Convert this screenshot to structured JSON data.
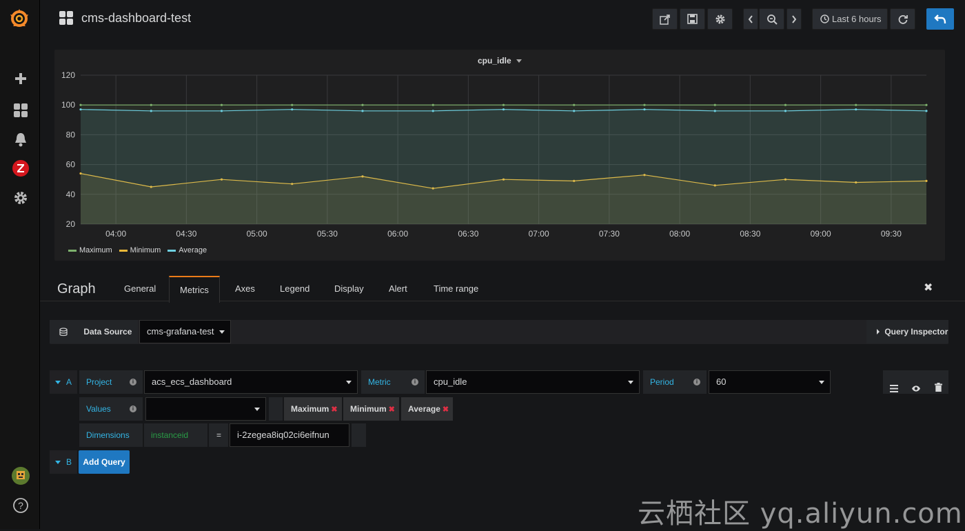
{
  "header": {
    "dashboard_title": "cms-dashboard-test",
    "time_range_label": "Last 6 hours"
  },
  "panel": {
    "title": "cpu_idle"
  },
  "chart_data": {
    "type": "line",
    "title": "cpu_idle",
    "ylim": [
      20,
      120
    ],
    "yticks": [
      120,
      100,
      80,
      60,
      40,
      20
    ],
    "xticks": [
      "04:00",
      "04:30",
      "05:00",
      "05:30",
      "06:00",
      "06:30",
      "07:00",
      "07:30",
      "08:00",
      "08:30",
      "09:00",
      "09:30"
    ],
    "x_start": "03:45",
    "x_end": "09:45",
    "grid": true,
    "legend_position": "bottom-left",
    "series": [
      {
        "name": "Maximum",
        "color": "#7eb26d",
        "values": [
          100,
          100,
          100,
          100,
          100,
          100,
          100,
          100,
          100,
          100,
          100,
          100,
          100
        ]
      },
      {
        "name": "Minimum",
        "color": "#eab839",
        "values": [
          54,
          45,
          50,
          47,
          52,
          44,
          50,
          49,
          53,
          46,
          50,
          48,
          49
        ]
      },
      {
        "name": "Average",
        "color": "#6ed0e0",
        "values": [
          97,
          96,
          96,
          97,
          96,
          96,
          97,
          96,
          97,
          96,
          96,
          97,
          96
        ]
      }
    ]
  },
  "editor": {
    "title": "Graph",
    "tabs": [
      "General",
      "Metrics",
      "Axes",
      "Legend",
      "Display",
      "Alert",
      "Time range"
    ],
    "active_tab": "Metrics"
  },
  "datasource": {
    "label": "Data Source",
    "value": "cms-grafana-test",
    "query_inspector": "Query Inspector"
  },
  "query_a": {
    "letter": "A",
    "project_label": "Project",
    "project_value": "acs_ecs_dashboard",
    "metric_label": "Metric",
    "metric_value": "cpu_idle",
    "period_label": "Period",
    "period_value": "60",
    "values_label": "Values",
    "values_tags": [
      "Maximum",
      "Minimum",
      "Average"
    ],
    "dimensions_label": "Dimensions",
    "dimension_key": "instanceid",
    "dimension_op": "=",
    "dimension_value": "i-2zegea8iq02ci6eifnun"
  },
  "query_b": {
    "letter": "B",
    "add_query_label": "Add Query"
  },
  "watermark": "云栖社区 yq.aliyun.com"
}
